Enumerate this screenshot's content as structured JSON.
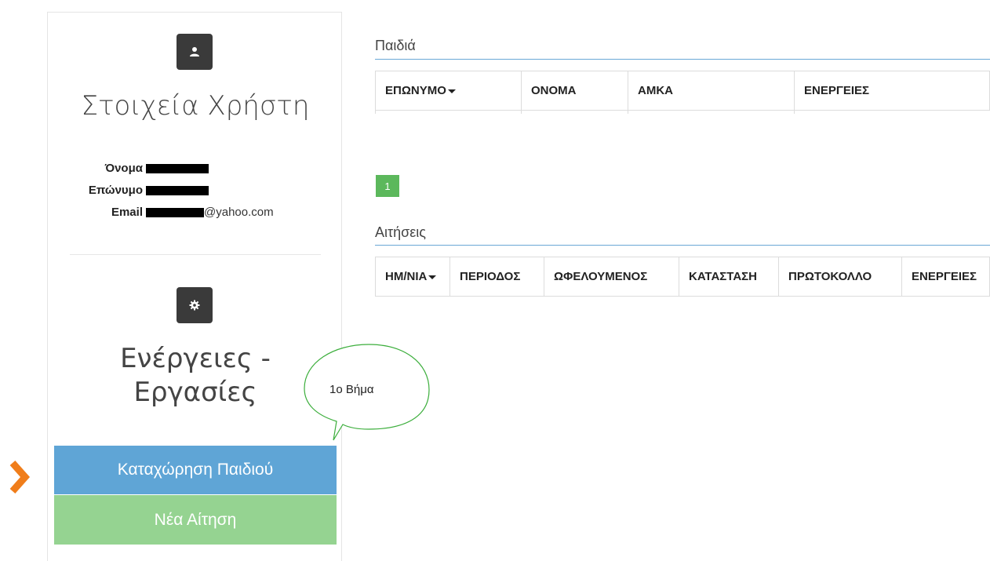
{
  "sidebar": {
    "user_title": "Στοιχεία Χρήστη",
    "fields": [
      {
        "label": "Όνομα",
        "value": ""
      },
      {
        "label": "Επώνυμο",
        "value": ""
      },
      {
        "label": "Email",
        "value": "@yahoo.com"
      }
    ],
    "actions_title_line1": "Ενέργειες -",
    "actions_title_line2": "Εργασίες",
    "buttons": {
      "register_child": "Καταχώρηση Παιδιού",
      "new_application": "Νέα Αίτηση"
    }
  },
  "annotation": {
    "bubble_text": "1ο Βήμα",
    "arrow_color": "#f07d1a"
  },
  "children_section": {
    "title": "Παιδιά",
    "columns": [
      "ΕΠΩΝΥΜΟ",
      "ΟΝΟΜΑ",
      "ΑΜΚΑ",
      "ΕΝΕΡΓΕΙΕΣ"
    ],
    "page": "1"
  },
  "applications_section": {
    "title": "Αιτήσεις",
    "columns": [
      "ΗΜ/ΝΙΑ",
      "ΠΕΡΙΟΔΟΣ",
      "ΩΦΕΛΟΥΜΕΝΟΣ",
      "ΚΑΤΑΣΤΑΣΗ",
      "ΠΡΩΤΟΚΟΛΛΟ",
      "ΕΝΕΡΓΕΙΕΣ"
    ]
  },
  "colors": {
    "primary_button": "#5fa5d6",
    "success_button": "#95d391",
    "page_active": "#5cb85c"
  }
}
